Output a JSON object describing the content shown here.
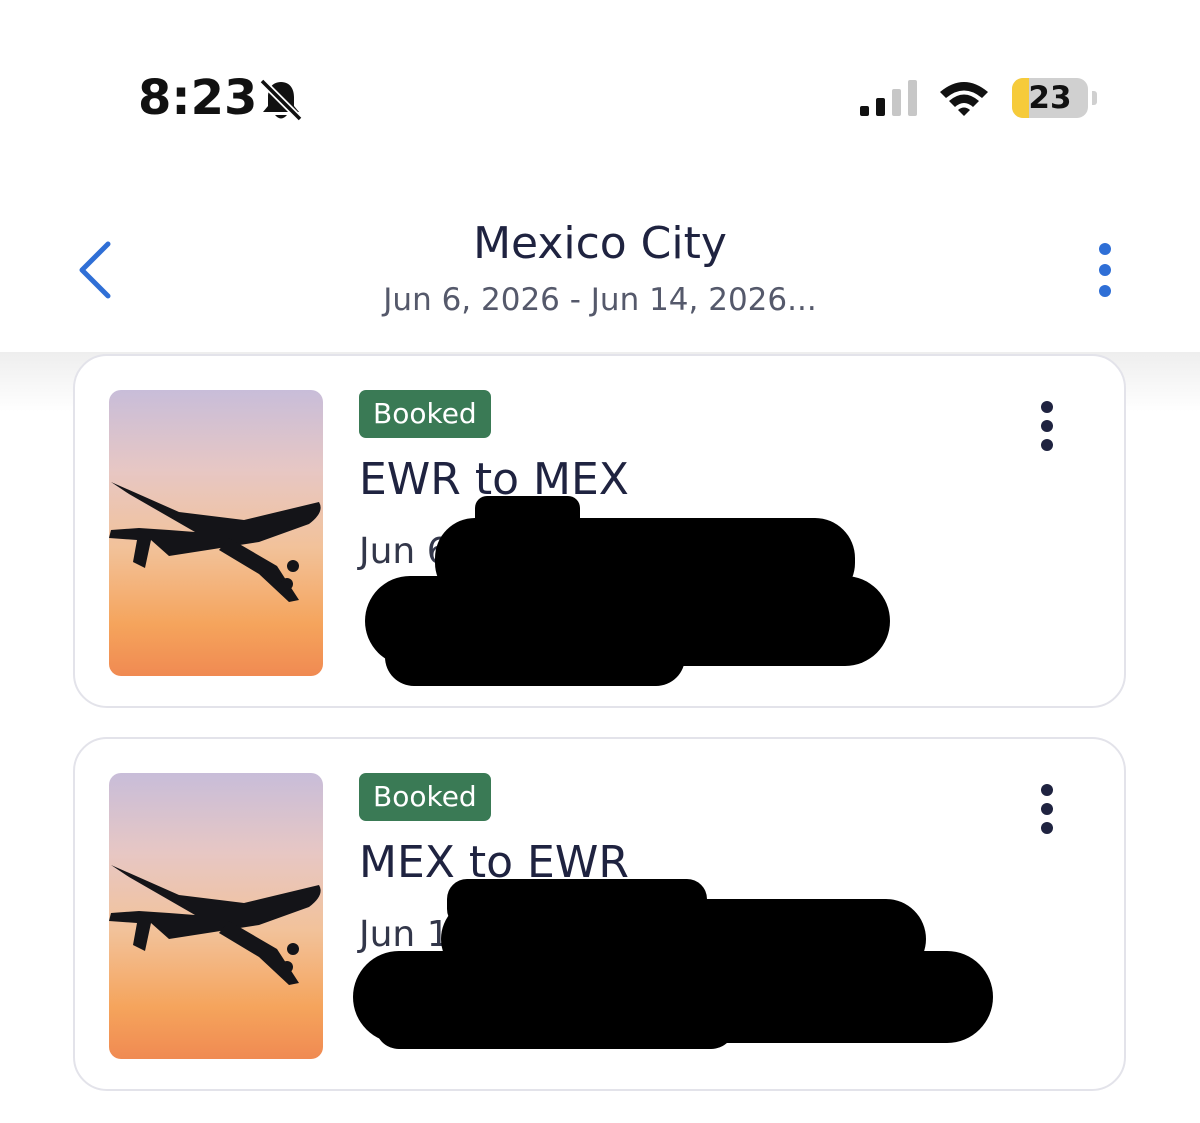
{
  "status_bar": {
    "time": "8:23",
    "battery_level": 23,
    "battery_text": "23",
    "icons": [
      "bell-slash-icon",
      "cellular-signal-icon",
      "wifi-icon",
      "battery-icon"
    ]
  },
  "header": {
    "title": "Mexico City",
    "subtitle": "Jun 6, 2026 - Jun 14, 2026...",
    "back_icon": "chevron-left-icon",
    "more_icon": "vertical-ellipsis-icon"
  },
  "trips": [
    {
      "status": "Booked",
      "route": "EWR to MEX",
      "date_visible": "Jun 6",
      "image": "airplane-sunset-image",
      "more_icon": "vertical-ellipsis-icon"
    },
    {
      "status": "Booked",
      "route": "MEX to EWR",
      "date_visible": "Jun 1",
      "image": "airplane-sunset-image",
      "more_icon": "vertical-ellipsis-icon"
    }
  ],
  "colors": {
    "accent": "#2f6fd6",
    "badge_bg": "#3a7a55",
    "title_text": "#1f2340",
    "battery_fill": "#f6cb3a"
  }
}
